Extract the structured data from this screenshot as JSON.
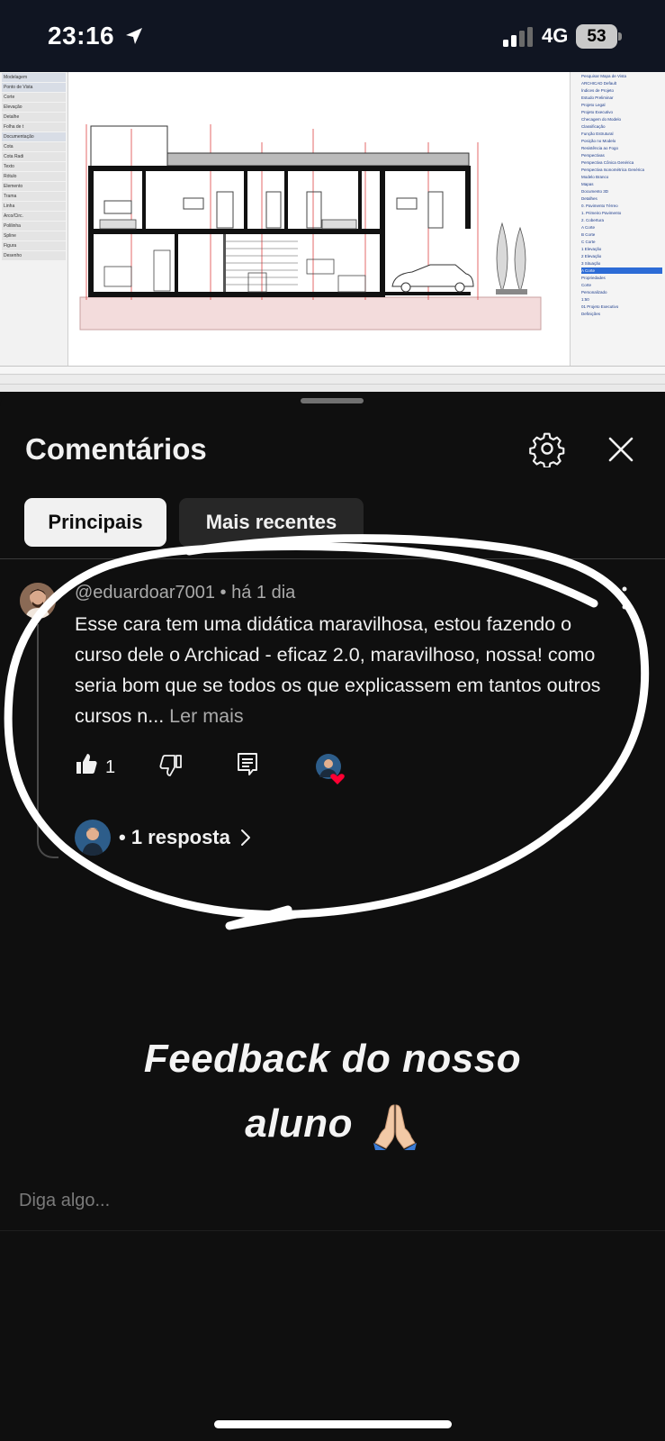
{
  "status_bar": {
    "time": "23:16",
    "network": "4G",
    "battery": "53"
  },
  "cad": {
    "left_panel": [
      "Modelagem",
      "Ponto de Vista",
      "Corte",
      "Elevação",
      "Detalhe",
      "Folha de t",
      "Documentação",
      "Cota",
      "Cota Radi",
      "Texto",
      "Rótulo",
      "Elemento",
      "Trama",
      "Linha",
      "Arco/Circ.",
      "Polilinha",
      "Spline",
      "Figura",
      "Desenho"
    ],
    "right_panel": [
      "Pesquisar Mapa de Vista",
      "ARCHICAD Default",
      "Índices de Projeto",
      "Estudo Preliminar",
      "Projeto Legal",
      "Projeto Executivo",
      "Checagem do Modelo",
      "Classificação",
      "Função Estrutural",
      "Posição no Modelo",
      "Resistência ao Fogo",
      "Perspectivas",
      "Perspectiva Cônica Genérica",
      "Perspectiva Isonométrica Genérica",
      "Modelo Branco",
      "Mapas",
      "Documento 3D",
      "Detalhes",
      "0. Pavimento Térreo",
      "1. Primeiro Pavimento",
      "2. Cobertura",
      "A Corte",
      "B Corte",
      "C Corte",
      "1 Elevação",
      "2 Elevação",
      "3 Situação",
      "A Corte",
      "Propriedades",
      "Corte",
      "Personalizado",
      "1:50",
      "01 Projeto Executivo",
      "Definições"
    ],
    "selected_item": "A Corte"
  },
  "sheet": {
    "title": "Comentários",
    "tabs": [
      {
        "label": "Principais",
        "active": true
      },
      {
        "label": "Mais recentes",
        "active": false
      }
    ]
  },
  "comment": {
    "author": "@eduardoar7001",
    "separator": "•",
    "time": "há 1 dia",
    "text": "Esse cara tem uma didática maravilhosa,  estou fazendo o curso dele  o Archicad - eficaz 2.0, maravilhoso, nossa! como seria bom que se todos os que explicassem em tantos outros cursos n...",
    "read_more": "Ler mais",
    "likes": "1",
    "replies_label": "• 1 resposta"
  },
  "overlay": {
    "line1": "Feedback do nosso",
    "line2": "aluno"
  },
  "input": {
    "placeholder": "Diga algo..."
  },
  "colors": {
    "background": "#0f0f0f",
    "chip_active": "#f1f1f1",
    "chip_inactive": "#272727",
    "secondary_text": "#aaaaaa",
    "heart": "#ff0033"
  },
  "icons": [
    "location-arrow-icon",
    "signal-bars-icon",
    "battery-icon",
    "gear-icon",
    "close-icon",
    "more-vert-icon",
    "thumb-up-icon",
    "thumb-down-icon",
    "reply-icon",
    "creator-heart-icon",
    "chevron-right-icon",
    "praying-hands-icon"
  ]
}
